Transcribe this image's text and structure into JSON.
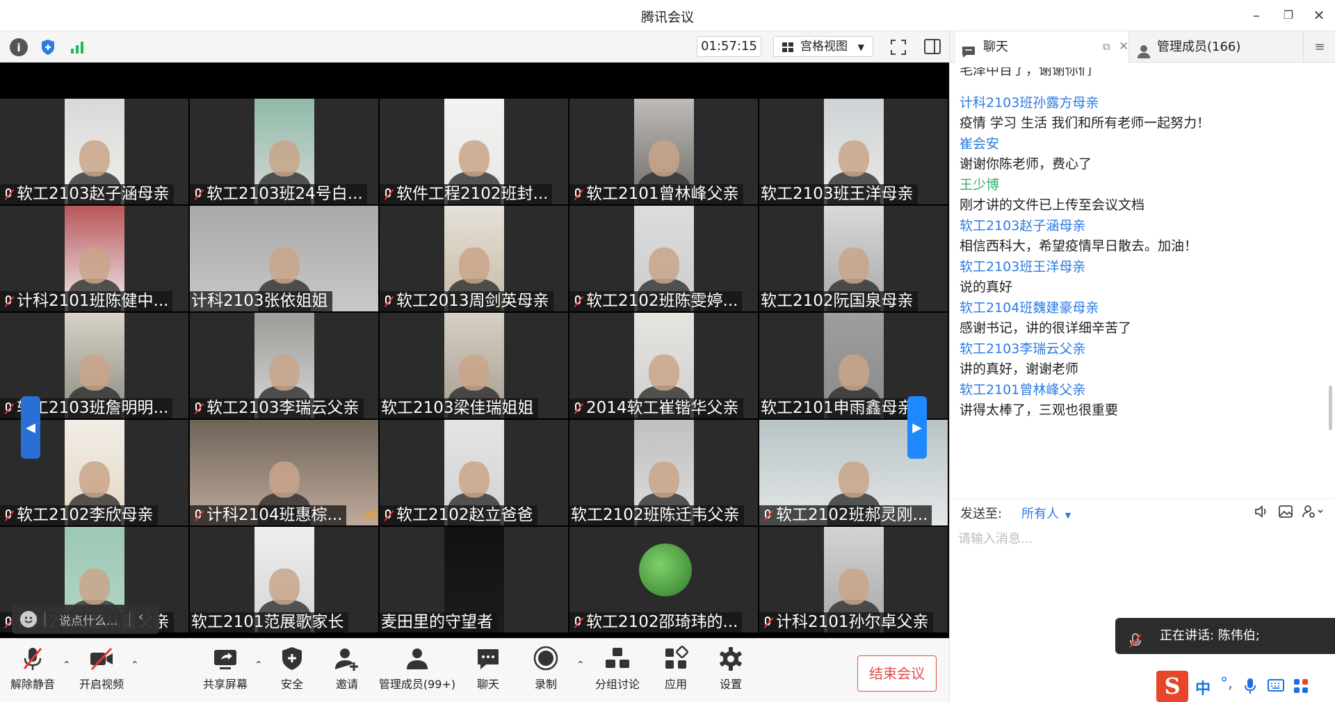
{
  "app": {
    "title": "腾讯会议"
  },
  "toolbar": {
    "timer": "01:57:15",
    "view_label": "宫格视图"
  },
  "tiles": [
    {
      "name": "软工2103赵子涵母亲",
      "muted": true
    },
    {
      "name": "软工2103班24号白...",
      "muted": true
    },
    {
      "name": "软件工程2102班封...",
      "muted": true
    },
    {
      "name": "软工2101曾林峰父亲",
      "muted": true
    },
    {
      "name": "软工2103班王洋母亲",
      "muted": false
    },
    {
      "name": "计科2101班陈健中...",
      "muted": true
    },
    {
      "name": "计科2103张依姐姐",
      "muted": false
    },
    {
      "name": "软工2013周剑英母亲",
      "muted": true
    },
    {
      "name": "软工2102班陈雯婷...",
      "muted": true
    },
    {
      "name": "软工2102阮国泉母亲",
      "muted": false
    },
    {
      "name": "软工2103班詹明明...",
      "muted": true
    },
    {
      "name": "软工2103李瑞云父亲",
      "muted": true
    },
    {
      "name": "软工2103梁佳瑞姐姐",
      "muted": false
    },
    {
      "name": "2014软工崔锴华父亲",
      "muted": true
    },
    {
      "name": "软工2101申雨鑫母亲",
      "muted": false
    },
    {
      "name": "软工2102李欣母亲",
      "muted": true
    },
    {
      "name": "计科2104班惠棕...",
      "muted": true
    },
    {
      "name": "软工2102赵立爸爸",
      "muted": true
    },
    {
      "name": "软工2102班陈迁韦父亲",
      "muted": false
    },
    {
      "name": "软工2102班郝灵刚...",
      "muted": true
    },
    {
      "name": "计科2103彭从善父亲",
      "muted": true
    },
    {
      "name": "软工2101范展歌家长",
      "muted": false
    },
    {
      "name": "麦田里的守望者",
      "muted": false
    },
    {
      "name": "软工2102邵琦玮的...",
      "muted": true
    },
    {
      "name": "计科2101孙尔卓父亲",
      "muted": true
    }
  ],
  "overlay": {
    "chat_placeholder": "说点什么..."
  },
  "panel": {
    "tab_chat": "聊天",
    "tab_members": "管理成员(166)",
    "partial_top": "毛泽中百了，谢谢你们",
    "messages": [
      {
        "sender": "计科2103班孙露方母亲",
        "text": "疫情 学习 生活 我们和所有老师一起努力！",
        "color": "blue"
      },
      {
        "sender": "崔会安",
        "text": "谢谢你陈老师，费心了",
        "color": "blue"
      },
      {
        "sender": "王少博",
        "text": "刚才讲的文件已上传至会议文档",
        "color": "green"
      },
      {
        "sender": "软工2103赵子涵母亲",
        "text": "相信西科大，希望疫情早日散去。加油！",
        "color": "blue"
      },
      {
        "sender": "软工2103班王洋母亲",
        "text": "说的真好",
        "color": "blue"
      },
      {
        "sender": "软工2104班魏建豪母亲",
        "text": "感谢书记，讲的很详细辛苦了",
        "color": "blue"
      },
      {
        "sender": "软工2103李瑞云父亲",
        "text": "讲的真好，谢谢老师",
        "color": "blue"
      },
      {
        "sender": "软工2101曾林峰父亲",
        "text": "讲得太棒了，三观也很重要",
        "color": "blue"
      }
    ],
    "send_to_label": "发送至:",
    "send_to_value": "所有人",
    "input_placeholder": "请输入消息..."
  },
  "speaking": {
    "text": "正在讲话: 陈伟伯;"
  },
  "bottom": {
    "unmute": "解除静音",
    "start_video": "开启视频",
    "share": "共享屏幕",
    "security": "安全",
    "invite": "邀请",
    "members": "管理成员(99+)",
    "chat": "聊天",
    "record": "录制",
    "breakout": "分组讨论",
    "apps": "应用",
    "settings": "设置",
    "end": "结束会议"
  },
  "ime": {
    "lang": "中"
  },
  "colors": {
    "accent": "#2a7be4",
    "danger": "#e04c4c",
    "speaker_green": "#35b06a",
    "toolbar_green": "#1db954"
  }
}
